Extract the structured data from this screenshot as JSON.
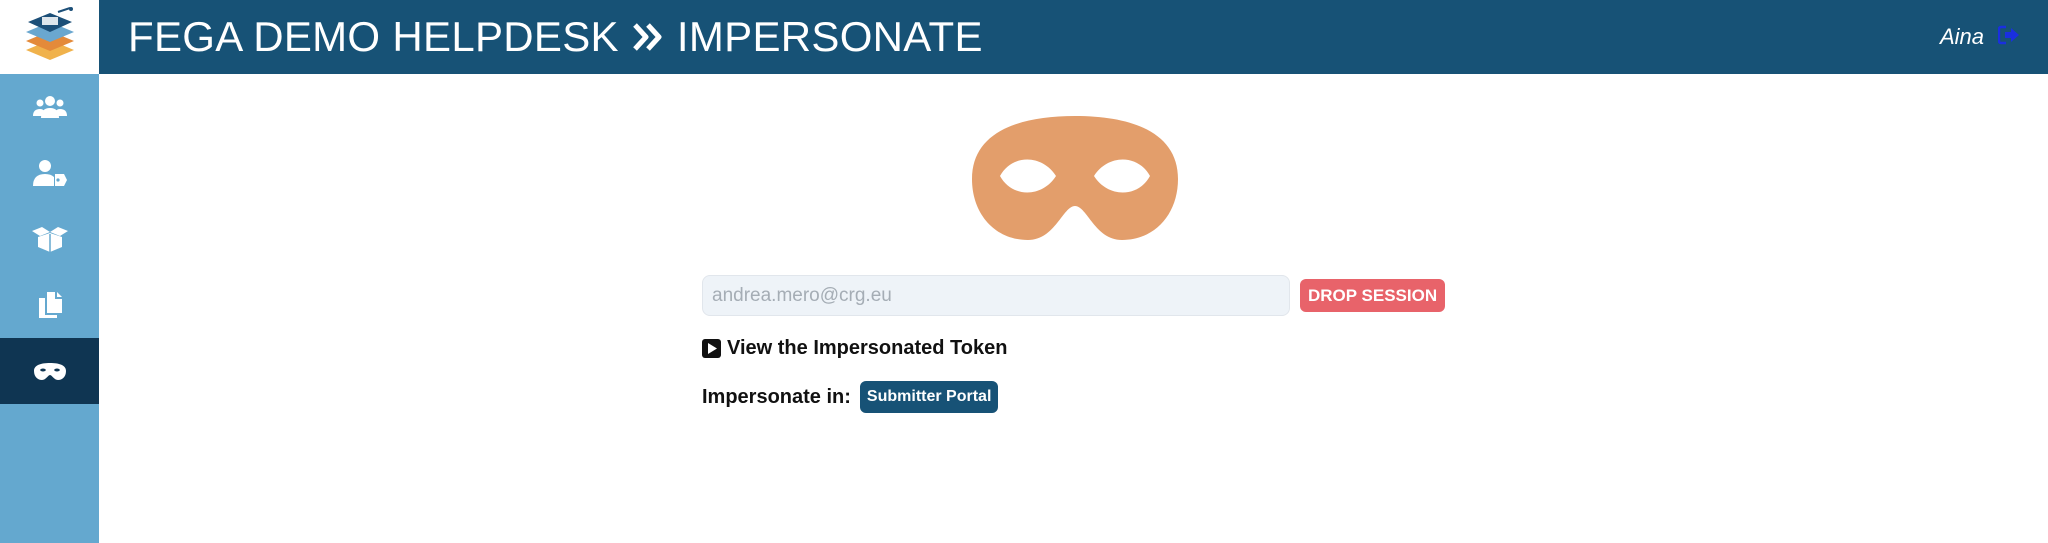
{
  "header": {
    "app_title": "FEGA DEMO HELPDESK",
    "page_title": "IMPERSONATE",
    "user_name": "Aina",
    "bg_color": "#175276"
  },
  "sidebar": {
    "bg_color": "#64a8cf",
    "active_color": "#0f3552",
    "items": [
      {
        "icon": "users-icon"
      },
      {
        "icon": "user-tag-icon"
      },
      {
        "icon": "open-box-icon"
      },
      {
        "icon": "documents-icon"
      },
      {
        "icon": "mask-icon",
        "active": true
      }
    ]
  },
  "impersonate": {
    "email_value": "andrea.mero@crg.eu",
    "drop_session_label": "DROP SESSION",
    "view_token_label": "View the Impersonated Token",
    "impersonate_in_label": "Impersonate in:",
    "portal_button_label": "Submitter Portal",
    "mask_color": "#e39e6b",
    "drop_color": "#e8636a"
  }
}
